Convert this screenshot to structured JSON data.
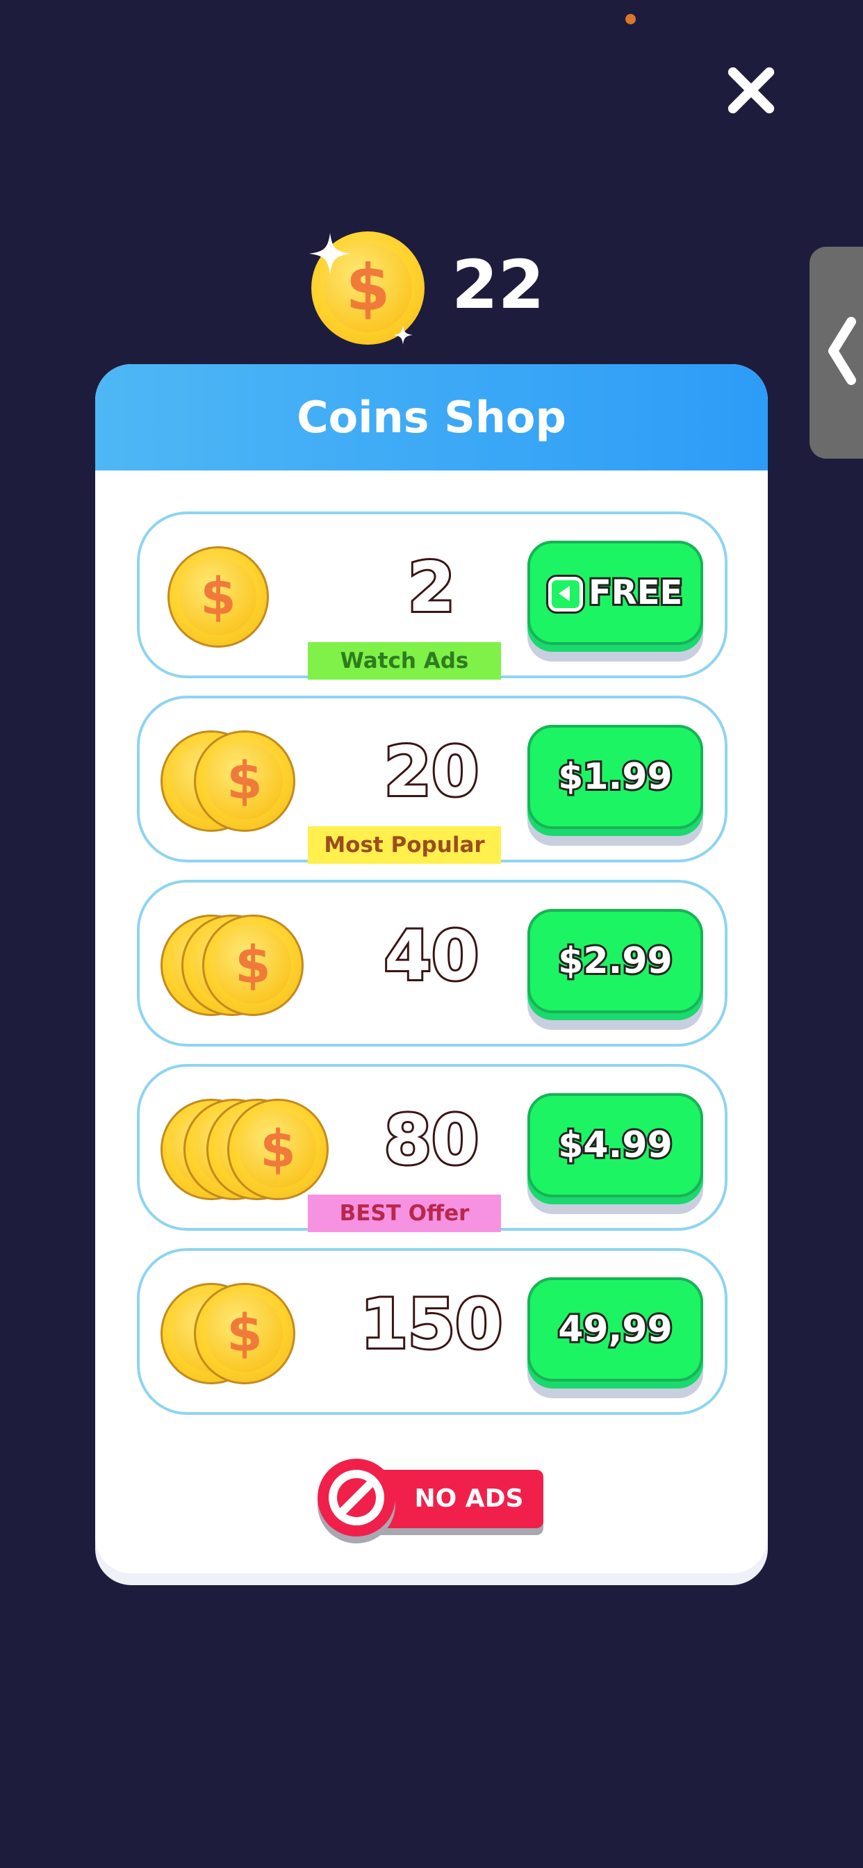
{
  "balance": {
    "value": "22",
    "icon": "coin-icon"
  },
  "shop": {
    "title": "Coins Shop",
    "items": [
      {
        "amount": "2",
        "tag": "Watch Ads",
        "button": "FREE",
        "coins": 1
      },
      {
        "amount": "20",
        "tag": "Most Popular",
        "button": "$1.99",
        "coins": 2
      },
      {
        "amount": "40",
        "tag": "",
        "button": "$2.99",
        "coins": 3
      },
      {
        "amount": "80",
        "tag": "BEST Offer",
        "button": "$4.99",
        "coins": 4
      },
      {
        "amount": "150",
        "tag": "",
        "button": "49,99",
        "coins": 2
      }
    ],
    "no_ads_label": "NO ADS"
  },
  "coin_symbol": "$",
  "colors": {
    "background": "#1e1c3c",
    "header": "#2d9cf7",
    "buy_button": "#1df463",
    "no_ads": "#f0204a"
  }
}
